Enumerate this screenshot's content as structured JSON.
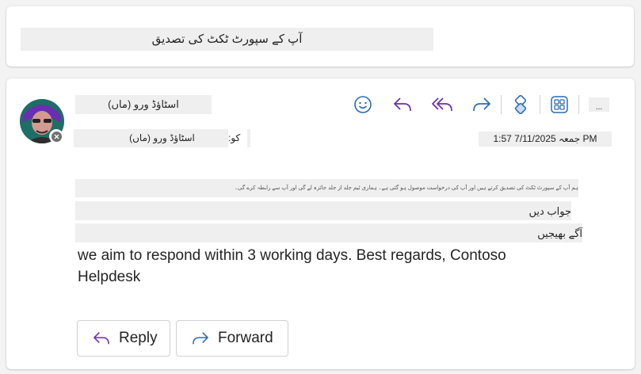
{
  "subject": "آپ کے سپورٹ ٹکٹ کی تصدیق",
  "sender": {
    "name": "اسٹاؤڈ ورو (ماں)"
  },
  "recipient": {
    "label": "کو:",
    "value": "اسٹاؤڈ ورو (ماں)"
  },
  "date": "جمعہ 7/11/2025 1:57 PM",
  "toolbar": {
    "emoji": "emoji-icon",
    "reply": "reply-icon",
    "reply_all": "reply-all-icon",
    "forward": "forward-icon",
    "loop": "loop-icon",
    "apps": "apps-icon",
    "more": "..."
  },
  "body": {
    "line1": "ہم آپ کے سپورٹ ٹکٹ کی تصدیق کرتے ہیں اور آپ کی درخواست موصول ہو گئی ہے۔ ہماری ٹیم جلد از جلد جائزہ لے گی اور آپ سے رابطہ کرے گی۔",
    "line2": "جواب دیں",
    "line3": "آگے بھیجیں",
    "text": "we aim to respond within 3 working days. Best regards, Contoso Helpdesk"
  },
  "actions": {
    "reply_label": "Reply",
    "forward_label": "Forward"
  },
  "colors": {
    "accent": "#6b2fa8",
    "forward_blue": "#2b6cb0"
  }
}
